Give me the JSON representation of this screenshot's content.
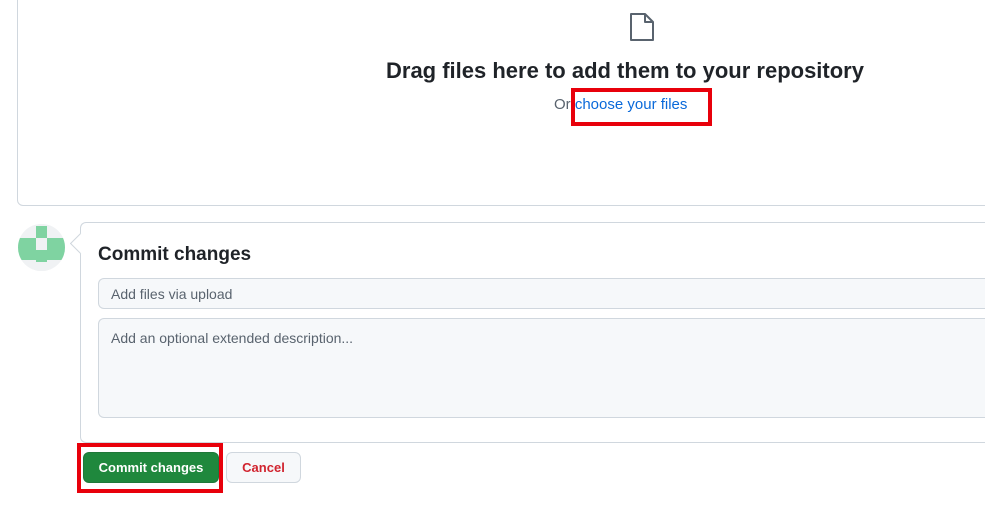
{
  "dropzone": {
    "icon": "file-icon",
    "title": "Drag files here to add them to your repository",
    "or_text": "Or ",
    "choose_link": "choose your files"
  },
  "commit": {
    "avatar": "identicon-avatar",
    "title": "Commit changes",
    "summary_placeholder": "Add files via upload",
    "summary_value": "",
    "description_placeholder": "Add an optional extended description...",
    "description_value": ""
  },
  "buttons": {
    "commit_label": "Commit changes",
    "cancel_label": "Cancel"
  },
  "colors": {
    "primary_button": "#1f883d",
    "cancel_text": "#d1242f",
    "link": "#0969da",
    "highlight": "#e8000b",
    "avatar": "#7fd3a1"
  }
}
